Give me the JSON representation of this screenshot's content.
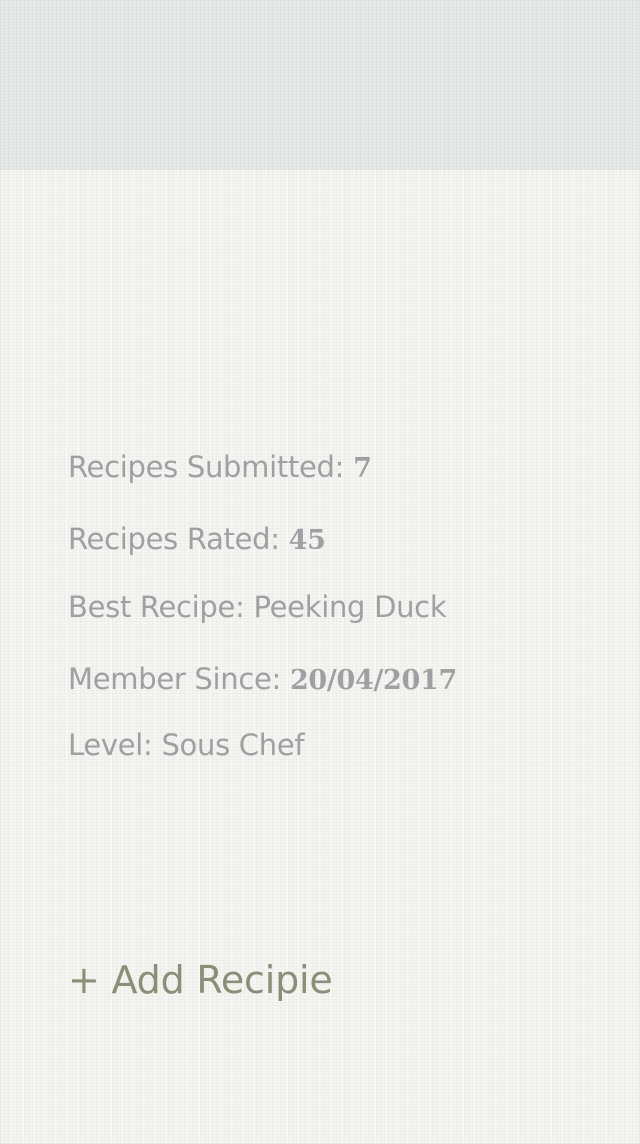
{
  "profile_stats": {
    "recipes_submitted": {
      "label": "Recipes Submitted:",
      "value": "7"
    },
    "recipes_rated": {
      "label": "Recipes Rated:",
      "value": "45"
    },
    "best_recipe": {
      "label": "Best Recipe:",
      "value": "Peeking Duck"
    },
    "member_since": {
      "label": "Member Since:",
      "value": "20/04/2017"
    },
    "level": {
      "label": "Level:",
      "value": "Sous Chef"
    }
  },
  "actions": {
    "add_recipe_label": "+ Add Recipie"
  },
  "colors": {
    "stat_text": "#a0a0a4",
    "action_text": "#8c8e78",
    "background": "#f4f4f1",
    "header_band": "#dee4e2"
  }
}
